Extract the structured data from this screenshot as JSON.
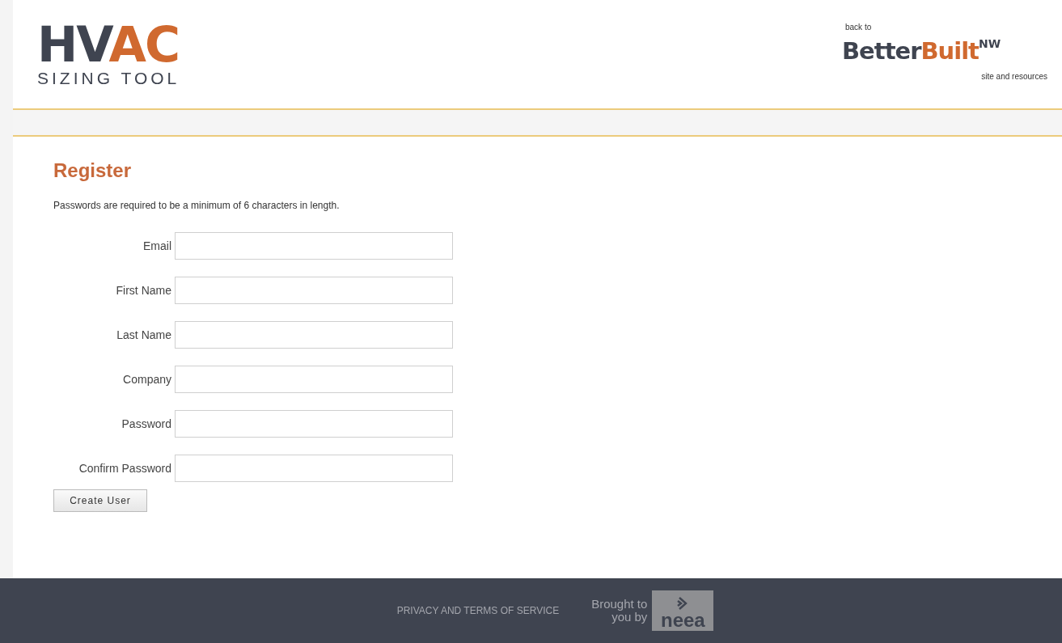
{
  "header": {
    "logo": {
      "parts": [
        "HV",
        "AC"
      ],
      "subtitle": "SIZING TOOL"
    },
    "back_link": {
      "prefix": "back to",
      "brand_parts": [
        "Better",
        "Built"
      ],
      "superscript": "NW",
      "suffix": "site and resources"
    }
  },
  "page": {
    "title": "Register",
    "note": "Passwords are required to be a minimum of 6 characters in length."
  },
  "form": {
    "fields": [
      {
        "label": "Email"
      },
      {
        "label": "First Name"
      },
      {
        "label": "Last Name"
      },
      {
        "label": "Company"
      },
      {
        "label": "Password"
      },
      {
        "label": "Confirm Password"
      }
    ],
    "submit": "Create User"
  },
  "footer": {
    "link": "PRIVACY AND TERMS OF SERVICE",
    "credit": [
      "Brought to",
      "you by"
    ],
    "sponsor": "neea"
  }
}
